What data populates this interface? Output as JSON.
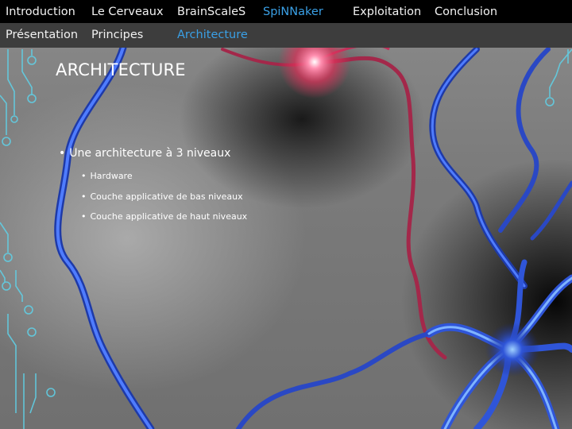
{
  "nav": {
    "primary": [
      {
        "label": "Introduction",
        "active": false
      },
      {
        "label": "Le Cerveaux",
        "active": false
      },
      {
        "label": "BrainScaleS",
        "active": false
      },
      {
        "label": "SpiNNaker",
        "active": true
      },
      {
        "label": "Exploitation",
        "active": false
      },
      {
        "label": "Conclusion",
        "active": false
      }
    ],
    "secondary": [
      {
        "label": "Présentation",
        "active": false
      },
      {
        "label": "Principes",
        "active": false
      },
      {
        "label": "Architecture",
        "active": true
      }
    ]
  },
  "slide": {
    "title": "ARCHITECTURE",
    "bullet": "Une architecture à 3 niveaux",
    "subbullets": [
      "Hardware",
      "Couche applicative de bas niveaux",
      "Couche applicative de haut niveaux"
    ]
  },
  "colors": {
    "nav_bg": "#000000",
    "subnav_bg": "#3d3d3d",
    "active": "#3aa0e6",
    "neuron_blue": "#2f55d8",
    "neuron_red": "#e0345c",
    "circuit_cyan": "#5fd3ea"
  },
  "icons": [
    "bullet-dot-icon"
  ]
}
